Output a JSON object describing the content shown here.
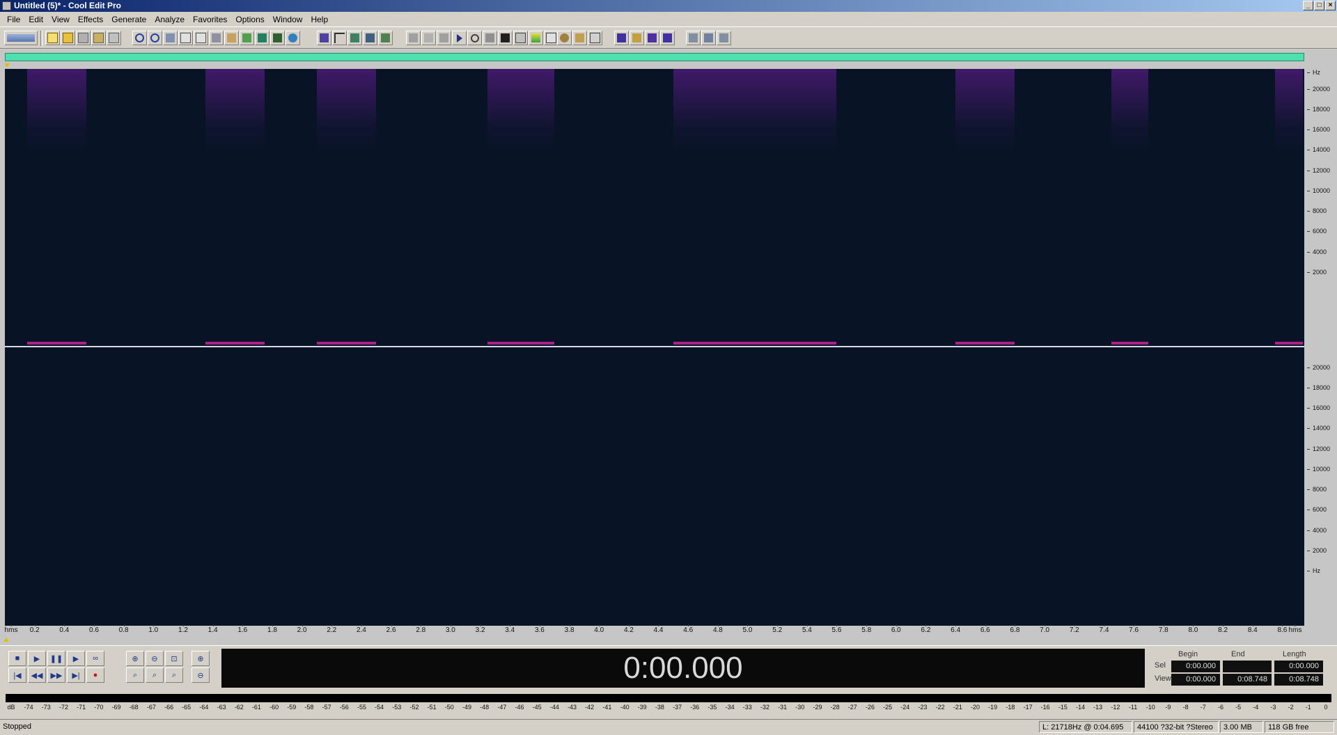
{
  "window": {
    "title": "Untitled (5)* - Cool Edit Pro",
    "min": "_",
    "max": "□",
    "close": "×"
  },
  "menu": [
    "File",
    "Edit",
    "View",
    "Effects",
    "Generate",
    "Analyze",
    "Favorites",
    "Options",
    "Window",
    "Help"
  ],
  "yaxis": {
    "unit": "Hz",
    "labels": [
      "20000",
      "18000",
      "16000",
      "14000",
      "12000",
      "10000",
      "8000",
      "6000",
      "4000",
      "2000"
    ]
  },
  "xaxis": {
    "start_label": "hms",
    "end_label": "hms",
    "labels": [
      "0.2",
      "0.4",
      "0.6",
      "0.8",
      "1.0",
      "1.2",
      "1.4",
      "1.6",
      "1.8",
      "2.0",
      "2.2",
      "2.4",
      "2.6",
      "2.8",
      "3.0",
      "3.2",
      "3.4",
      "3.6",
      "3.8",
      "4.0",
      "4.2",
      "4.4",
      "4.6",
      "4.8",
      "5.0",
      "5.2",
      "5.4",
      "5.6",
      "5.8",
      "6.0",
      "6.2",
      "6.4",
      "6.6",
      "6.8",
      "7.0",
      "7.2",
      "7.4",
      "7.6",
      "7.8",
      "8.0",
      "8.2",
      "8.4",
      "8.6"
    ]
  },
  "spectrogram": {
    "duration_s": 8.748,
    "bursts_s": [
      [
        0.15,
        0.55
      ],
      [
        1.35,
        1.75
      ],
      [
        2.1,
        2.5
      ],
      [
        3.25,
        3.7
      ],
      [
        4.5,
        5.6
      ],
      [
        6.4,
        6.8
      ],
      [
        7.45,
        7.7
      ],
      [
        8.55,
        8.74
      ]
    ]
  },
  "time_display": "0:00.000",
  "selection": {
    "headers": [
      "Begin",
      "End",
      "Length"
    ],
    "sel_label": "Sel",
    "view_label": "View",
    "sel": [
      "0:00.000",
      "",
      "0:00.000"
    ],
    "view": [
      "0:00.000",
      "0:08.748",
      "0:08.748"
    ]
  },
  "level_scale": [
    "dB",
    "-74",
    "-73",
    "-72",
    "-71",
    "-70",
    "-69",
    "-68",
    "-67",
    "-66",
    "-65",
    "-64",
    "-63",
    "-62",
    "-61",
    "-60",
    "-59",
    "-58",
    "-57",
    "-56",
    "-55",
    "-54",
    "-53",
    "-52",
    "-51",
    "-50",
    "-49",
    "-48",
    "-47",
    "-46",
    "-45",
    "-44",
    "-43",
    "-42",
    "-41",
    "-40",
    "-39",
    "-38",
    "-37",
    "-36",
    "-35",
    "-34",
    "-33",
    "-32",
    "-31",
    "-30",
    "-29",
    "-28",
    "-27",
    "-26",
    "-25",
    "-24",
    "-23",
    "-22",
    "-21",
    "-20",
    "-19",
    "-18",
    "-17",
    "-16",
    "-15",
    "-14",
    "-13",
    "-12",
    "-11",
    "-10",
    "-9",
    "-8",
    "-7",
    "-6",
    "-5",
    "-4",
    "-3",
    "-2",
    "-1",
    "0"
  ],
  "status": {
    "state": "Stopped",
    "cursor": "L: 21718Hz @   0:04.695",
    "format": "44100 ?32-bit ?Stereo",
    "size": "3.00 MB",
    "free": "118 GB free"
  },
  "colors": {
    "accent": "#0a246a",
    "overview": "#4fe0b0",
    "spectro_bg": "#081426",
    "burst": "#b0208a"
  },
  "transport_icons": [
    "stop-icon",
    "play-icon",
    "pause-icon",
    "play-to-end-icon",
    "loop-icon",
    "go-start-icon",
    "rewind-icon",
    "fast-forward-icon",
    "go-end-icon",
    "record-icon"
  ],
  "zoom_icons": [
    "zoom-in-icon",
    "zoom-out-icon",
    "zoom-full-icon",
    "zoom-in-vertical-icon",
    "zoom-left-icon",
    "zoom-right-icon",
    "zoom-selection-icon",
    "zoom-out-vertical-icon"
  ],
  "transport_glyphs": [
    "■",
    "▶",
    "❚❚",
    "▶",
    "∞",
    "|◀",
    "◀◀",
    "▶▶",
    "▶|",
    "●"
  ],
  "zoom_glyphs": [
    "⊕",
    "⊖",
    "⊡",
    "⊕",
    "⌕",
    "⌕",
    "⌕",
    "⊖"
  ]
}
